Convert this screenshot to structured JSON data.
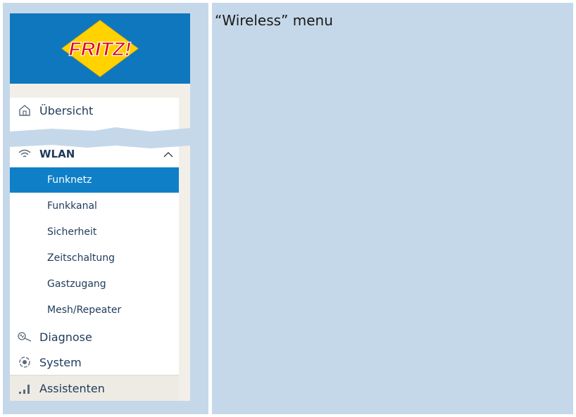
{
  "caption": "“Wireless” menu",
  "logo": {
    "brand_text": "FRITZ!",
    "brand_color": "#0f77be",
    "logo_fill": "#ffd200",
    "logo_text_color": "#e2001a"
  },
  "menu": {
    "overview": {
      "label": "Übersicht",
      "icon": "home-icon"
    },
    "wlan": {
      "label": "WLAN",
      "icon": "wifi-icon",
      "expanded": true,
      "items": [
        {
          "label": "Funknetz",
          "active": true
        },
        {
          "label": "Funkkanal",
          "active": false
        },
        {
          "label": "Sicherheit",
          "active": false
        },
        {
          "label": "Zeitschaltung",
          "active": false
        },
        {
          "label": "Gastzugang",
          "active": false
        },
        {
          "label": "Mesh/Repeater",
          "active": false
        }
      ]
    },
    "diagnose": {
      "label": "Diagnose",
      "icon": "diagnose-icon"
    },
    "system": {
      "label": "System",
      "icon": "system-icon"
    },
    "assistants": {
      "label": "Assistenten",
      "icon": "assistant-icon"
    }
  },
  "colors": {
    "background": "#c5d8ea",
    "active_item": "#0f7fc8",
    "menu_text": "#1f3a5a"
  }
}
